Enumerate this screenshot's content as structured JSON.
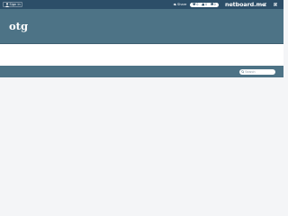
{
  "topbar": {
    "signin_label": "Sign in",
    "share_label": "Share",
    "counters": [
      {
        "icon": "heart-icon",
        "value": "0"
      },
      {
        "icon": "thumbs-up-icon",
        "value": "0"
      },
      {
        "icon": "comment-icon",
        "value": "0"
      }
    ],
    "brand": "netboard.me",
    "colors": {
      "bar": "#2c4e68",
      "text": "#ffffff"
    }
  },
  "header": {
    "title": "otg",
    "background": "#4d7386"
  },
  "toolbar": {
    "search_placeholder": "Search"
  }
}
